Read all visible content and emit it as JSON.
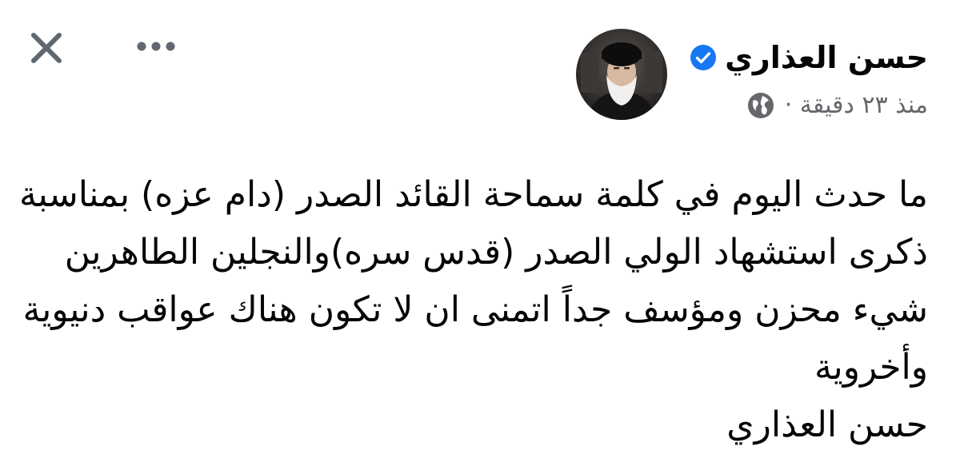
{
  "post": {
    "author_name": "حسن العذاري",
    "verified": true,
    "timestamp": "منذ ٢٣ دقيقة ·",
    "audience_icon": "globe-icon",
    "lines": [
      "ما حدث اليوم في كلمة سماحة القائد الصدر (دام عزه) بمناسبة",
      "ذكرى استشهاد الولي الصدر (قدس سره)والنجلين الطاهرين",
      "شيء محزن ومؤسف جداً اتمنى ان لا تكون هناك عواقب دنيوية",
      "وأخروية",
      "حسن العذاري"
    ]
  },
  "toolbar": {
    "close_icon": "close-icon",
    "more_icon": "more-options-icon"
  },
  "colors": {
    "verified": "#1877f2",
    "secondary_text": "#65676b",
    "icon": "#606770"
  }
}
